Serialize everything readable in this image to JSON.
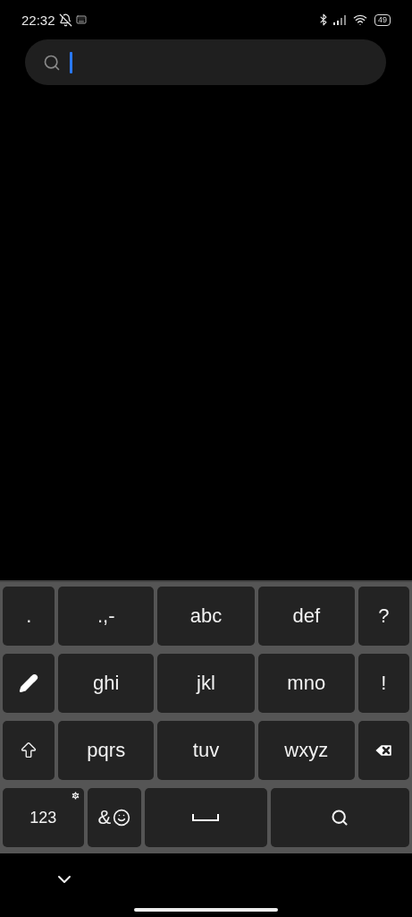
{
  "status_bar": {
    "time": "22:32",
    "battery": "49"
  },
  "search": {
    "focused": true
  },
  "keyboard": {
    "rows": [
      {
        "keys": [
          {
            "kind": "text",
            "label": "."
          },
          {
            "kind": "text",
            "label": ".,-"
          },
          {
            "kind": "text",
            "label": "abc"
          },
          {
            "kind": "text",
            "label": "def"
          },
          {
            "kind": "text",
            "label": "?"
          }
        ]
      },
      {
        "keys": [
          {
            "kind": "pencil"
          },
          {
            "kind": "text",
            "label": "ghi"
          },
          {
            "kind": "text",
            "label": "jkl"
          },
          {
            "kind": "text",
            "label": "mno"
          },
          {
            "kind": "text",
            "label": "!"
          }
        ]
      },
      {
        "keys": [
          {
            "kind": "shift"
          },
          {
            "kind": "text",
            "label": "pqrs"
          },
          {
            "kind": "text",
            "label": "tuv"
          },
          {
            "kind": "text",
            "label": "wxyz"
          },
          {
            "kind": "backspace"
          }
        ]
      },
      {
        "keys": [
          {
            "kind": "numbers",
            "label": "123"
          },
          {
            "kind": "symbols",
            "label": "&"
          },
          {
            "kind": "space"
          },
          {
            "kind": "search"
          }
        ]
      }
    ]
  }
}
